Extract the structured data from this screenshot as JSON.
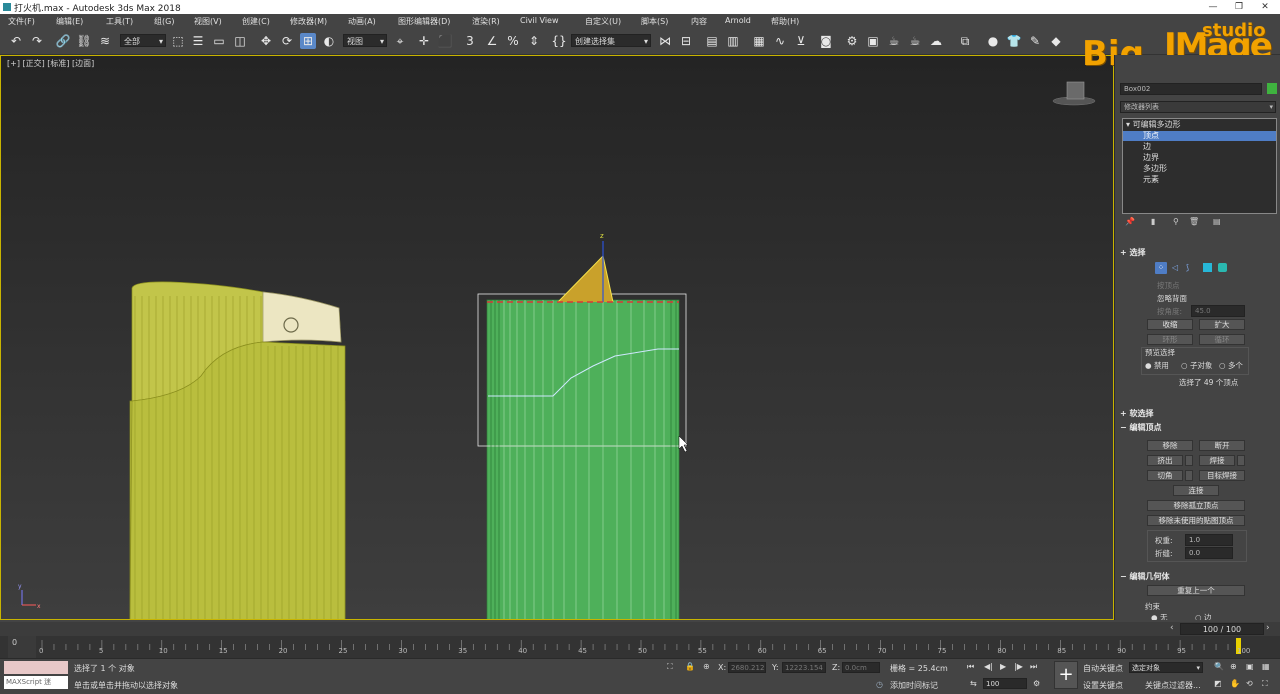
{
  "window": {
    "title": "打火机.max - Autodesk 3ds Max 2018"
  },
  "menubar": {
    "items": [
      "文件(F)",
      "编辑(E)",
      "工具(T)",
      "组(G)",
      "视图(V)",
      "创建(C)",
      "修改器(M)",
      "动画(A)",
      "图形编辑器(D)",
      "渲染(R)",
      "Civil View",
      "自定义(U)",
      "脚本(S)",
      "内容",
      "Arnold",
      "帮助(H)"
    ]
  },
  "toolbar": {
    "selection_filter": "全部",
    "view_coord": "视图",
    "named_selection": "创建选择集"
  },
  "viewport": {
    "label": "[+] [正交] [标准] [边面]",
    "axis_y": "y",
    "axis_x": "x",
    "gizmo_z": "z"
  },
  "command_panel": {
    "object_name": "Box002",
    "modifier_list": "修改器列表",
    "stack": {
      "root": "可编辑多边形",
      "items": [
        "顶点",
        "边",
        "边界",
        "多边形",
        "元素"
      ]
    },
    "selection": {
      "title": "选择",
      "by_vertex": "按顶点",
      "ignore_backface": "忽略背面",
      "by_angle": "按角度:",
      "angle_value": "45.0",
      "shrink": "收缩",
      "grow": "扩大",
      "ring": "环形",
      "loop": "循环",
      "preview_title": "预览选择",
      "preview_off": "禁用",
      "preview_subobj": "子对象",
      "preview_multi": "多个",
      "status": "选择了 49 个顶点"
    },
    "soft_selection": {
      "title": "软选择"
    },
    "edit_vertices": {
      "title": "编辑顶点",
      "remove": "移除",
      "break": "断开",
      "extrude": "挤出",
      "weld": "焊接",
      "chamfer": "切角",
      "target_weld": "目标焊接",
      "connect": "连接",
      "remove_isolated": "移除孤立顶点",
      "remove_unused_map": "移除未使用的贴图顶点",
      "weight_label": "权重:",
      "weight_value": "1.0",
      "crease_label": "折缝:",
      "crease_value": "0.0"
    },
    "edit_geometry": {
      "title": "编辑几何体",
      "repeat_last": "重复上一个",
      "constraints": "约束",
      "constraint_none": "无",
      "constraint_edge": "边"
    }
  },
  "timeline": {
    "frame_display": "100 / 100",
    "frame_current": "0",
    "ticks": [
      "0",
      "5",
      "10",
      "15",
      "20",
      "25",
      "30",
      "35",
      "40",
      "45",
      "50",
      "55",
      "60",
      "65",
      "70",
      "75",
      "80",
      "85",
      "90",
      "95",
      "100"
    ]
  },
  "statusbar": {
    "maxscript": "MAXScript 迷",
    "status_line": "选择了 1 个 对象",
    "prompt": "单击或单击并拖动以选择对象",
    "x_label": "X:",
    "x_value": "2680.212",
    "y_label": "Y:",
    "y_value": "12223.154",
    "z_label": "Z:",
    "z_value": "0.0cm",
    "grid": "栅格 = 25.4cm",
    "add_time_tag": "添加时间标记",
    "auto_key": "自动关键点",
    "key_mode": "选定对象",
    "set_key": "设置关键点",
    "key_filters": "关键点过滤器...",
    "frame_field": "100"
  },
  "watermark": {
    "text1": "Big",
    "text2": "IMage",
    "text3": "studio"
  },
  "colors": {
    "accent_blue": "#4f7dc5",
    "viewport_border": "#c8b400",
    "lighter_body": "#b8bc3c",
    "box_green": "#4eb05a"
  }
}
